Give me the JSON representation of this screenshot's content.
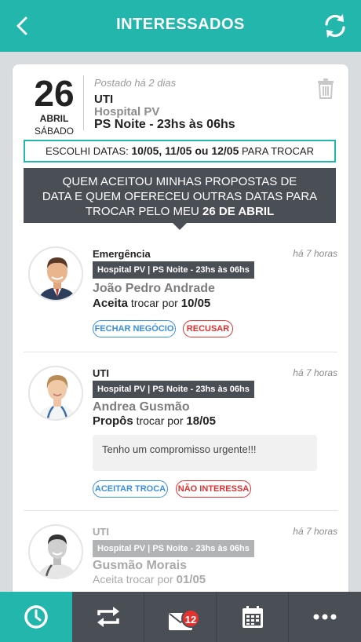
{
  "header": {
    "title": "INTERESSADOS"
  },
  "post": {
    "day": "26",
    "month": "ABRIL",
    "weekday": "SÁBADO",
    "posted": "Postado há 2 dias",
    "dept": "UTI",
    "hospital": "Hospital PV",
    "shift": "PS Noite - 23hs às 06hs",
    "chosen_prefix": "ESCOLHI DATAS: ",
    "chosen_dates": "10/05, 11/05 ou 12/05",
    "chosen_suffix": " PARA TROCAR",
    "banner_line1": "QUEM ACEITOU MINHAS PROPOSTAS DE",
    "banner_line2": "DATA E QUEM OFERECEU OUTRAS DATAS PARA",
    "banner_line3_prefix": "TROCAR PELO MEU ",
    "banner_line3_bold": "26 DE ABRIL"
  },
  "interested": [
    {
      "dept": "Emergência",
      "time": "há 7 horas",
      "tag": "Hospital PV | PS Noite - 23hs às 06hs",
      "name": "João Pedro Andrade",
      "action_verb": "Aceita",
      "action_rest": " trocar por ",
      "action_date": "10/05",
      "btn_primary": "FECHAR NEGÓCIO",
      "btn_secondary": "RECUSAR"
    },
    {
      "dept": "UTI",
      "time": "há 7 horas",
      "tag": "Hospital PV | PS Noite - 23hs às 06hs",
      "name": "Andrea Gusmão",
      "action_verb": "Propôs",
      "action_rest": " trocar por ",
      "action_date": "18/05",
      "message": "Tenho um compromisso urgente!!!",
      "btn_primary": "ACEITAR TROCA",
      "btn_secondary": "NÃO INTERESSA"
    },
    {
      "dept": "UTI",
      "time": "há 7 horas",
      "tag": "Hospital PV | PS Noite - 23hs às 06hs",
      "name": "Gusmão Morais",
      "action_text": "Aceita trocar por ",
      "action_date": "01/05"
    }
  ],
  "tabbar": {
    "badge": "12",
    "icons": [
      "clock-icon",
      "swap-icon",
      "mail-icon",
      "calendar-icon",
      "more-icon"
    ]
  },
  "colors": {
    "primary": "#23b6ad",
    "dark": "#4a4f56",
    "blue": "#3a8ee0",
    "red": "#e0302f"
  }
}
